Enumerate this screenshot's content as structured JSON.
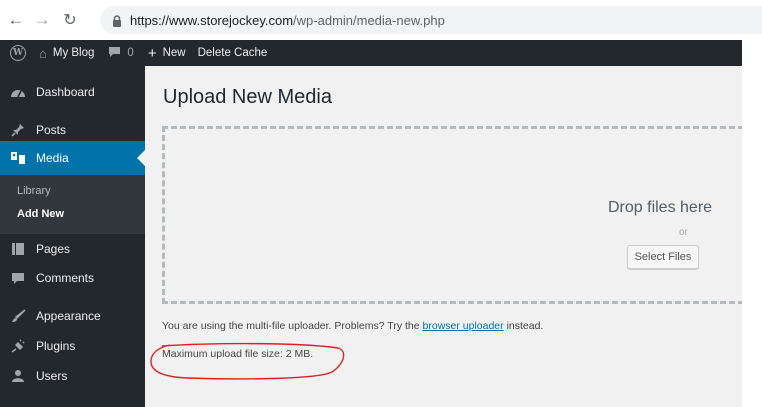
{
  "browser": {
    "url_host": "https://www.storejockey.com",
    "url_path": "/wp-admin/media-new.php",
    "icons": [
      "back-arrow-icon",
      "forward-arrow-icon",
      "reload-icon",
      "lock-icon"
    ]
  },
  "admin_bar": {
    "site_name": "My Blog",
    "comment_count": "0",
    "new_label": "New",
    "delete_cache_label": "Delete Cache"
  },
  "sidebar": {
    "items": [
      {
        "label": "Dashboard",
        "icon": "dashboard-icon"
      },
      {
        "label": "Posts",
        "icon": "pin-icon"
      },
      {
        "label": "Media",
        "icon": "media-icon",
        "active": true
      },
      {
        "label": "Pages",
        "icon": "pages-icon"
      },
      {
        "label": "Comments",
        "icon": "comment-icon"
      },
      {
        "label": "Appearance",
        "icon": "brush-icon"
      },
      {
        "label": "Plugins",
        "icon": "plugin-icon"
      },
      {
        "label": "Users",
        "icon": "users-icon"
      }
    ],
    "submenu": [
      {
        "label": "Library"
      },
      {
        "label": "Add New",
        "current": true
      }
    ]
  },
  "main": {
    "title": "Upload New Media",
    "drop_title": "Drop files here",
    "drop_or": "or",
    "select_button": "Select Files",
    "info_prefix": "You are using the multi-file uploader. Problems? Try the ",
    "info_link": "browser uploader",
    "info_suffix": " instead.",
    "max_size": "Maximum upload file size: 2 MB."
  },
  "colors": {
    "admin_dark": "#23282d",
    "submenu_bg": "#32373c",
    "accent": "#0073aa",
    "content_bg": "#f1f1f1",
    "annotation": "#e02020"
  }
}
